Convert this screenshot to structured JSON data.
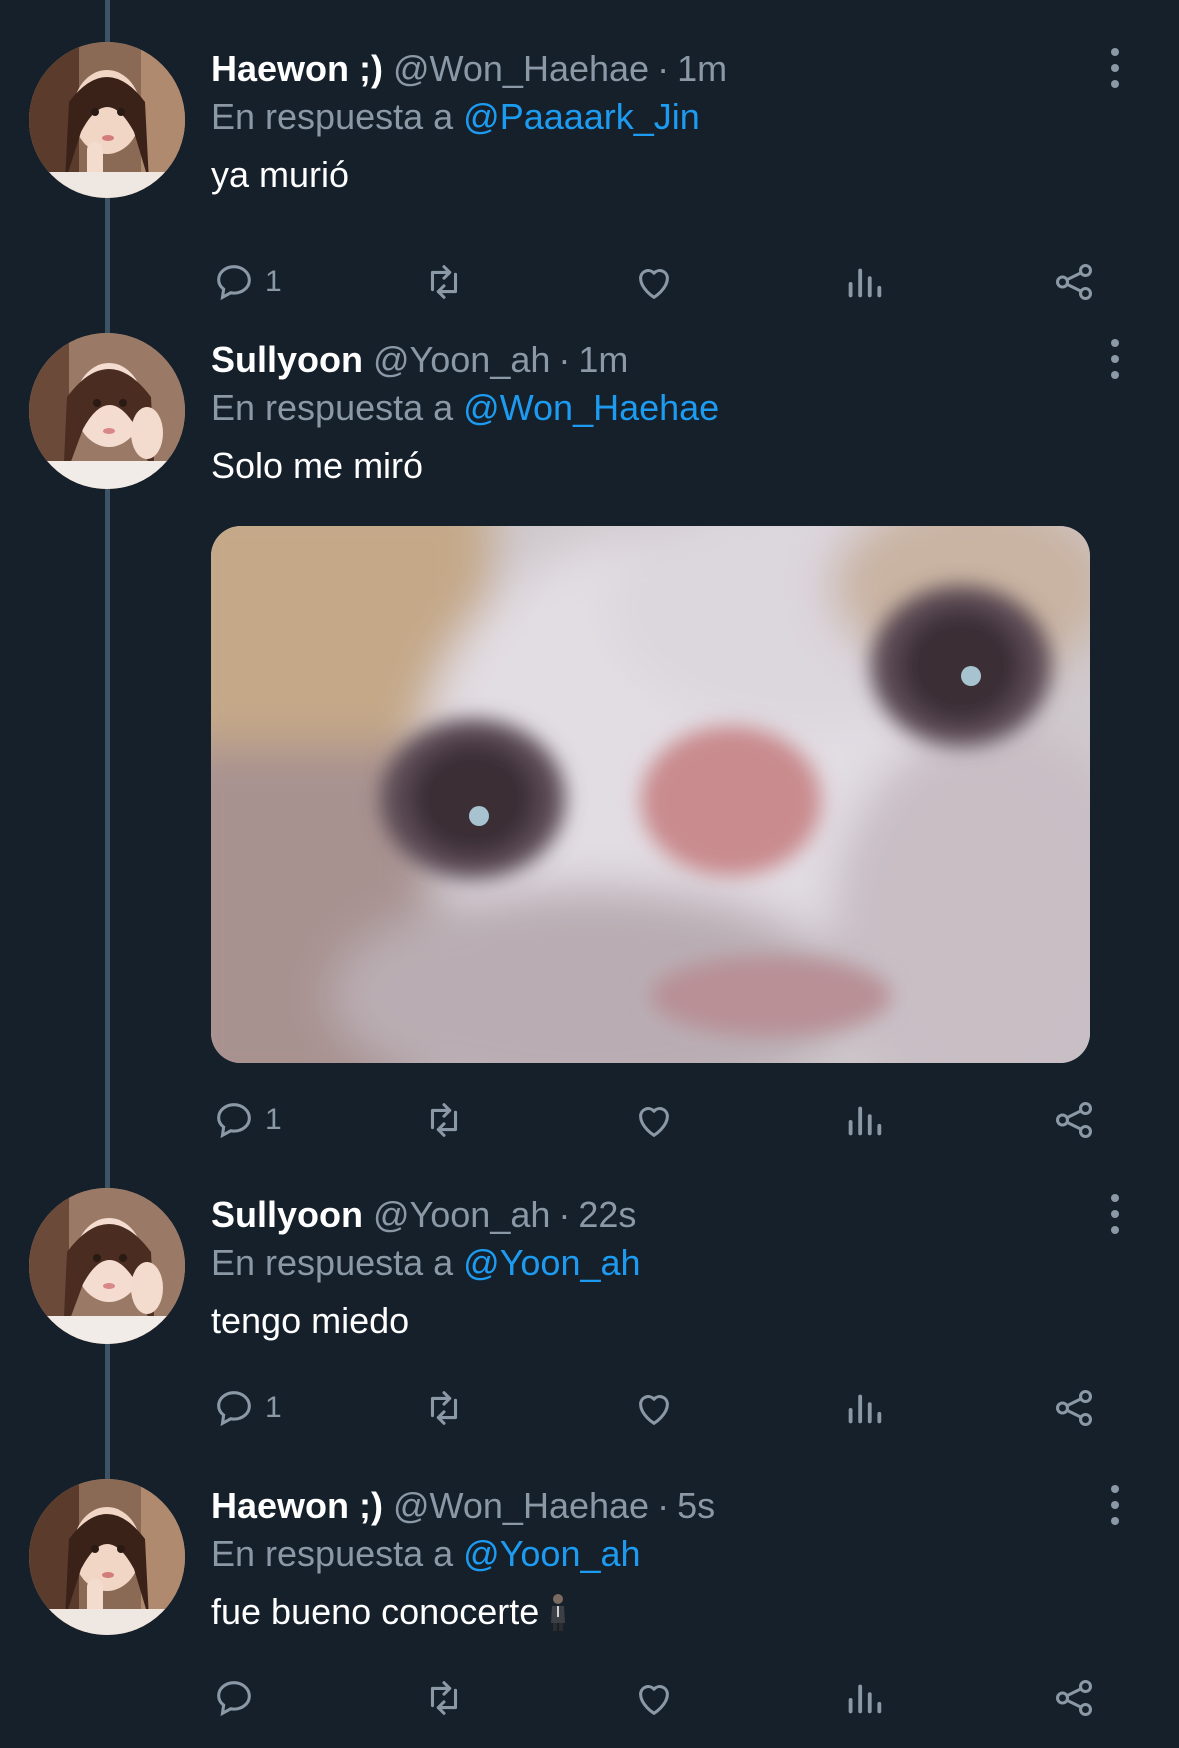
{
  "tweets": [
    {
      "name": "Haewon ;)",
      "handle": "@Won_Haehae",
      "separator": "·",
      "time": "1m",
      "reply_prefix": "En respuesta a",
      "reply_to": "@Paaaark_Jin",
      "text": "ya murió",
      "reply_count": "1"
    },
    {
      "name": "Sullyoon",
      "handle": "@Yoon_ah",
      "separator": "·",
      "time": "1m",
      "reply_prefix": "En respuesta a",
      "reply_to": "@Won_Haehae",
      "text": "Solo me miró",
      "reply_count": "1"
    },
    {
      "name": "Sullyoon",
      "handle": "@Yoon_ah",
      "separator": "·",
      "time": "22s",
      "reply_prefix": "En respuesta a",
      "reply_to": "@Yoon_ah",
      "text": "tengo miedo",
      "reply_count": "1"
    },
    {
      "name": "Haewon ;)",
      "handle": "@Won_Haehae",
      "separator": "·",
      "time": "5s",
      "reply_prefix": "En respuesta a",
      "reply_to": "@Yoon_ah",
      "text": "fue bueno conocerte",
      "reply_count": ""
    }
  ],
  "colors": {
    "background": "#15202b",
    "muted": "#8b98a5",
    "link": "#1d9bf0",
    "thread_line": "#3d5466"
  },
  "icons": [
    "reply-icon",
    "retweet-icon",
    "like-icon",
    "views-icon",
    "share-icon",
    "more-options-icon"
  ]
}
